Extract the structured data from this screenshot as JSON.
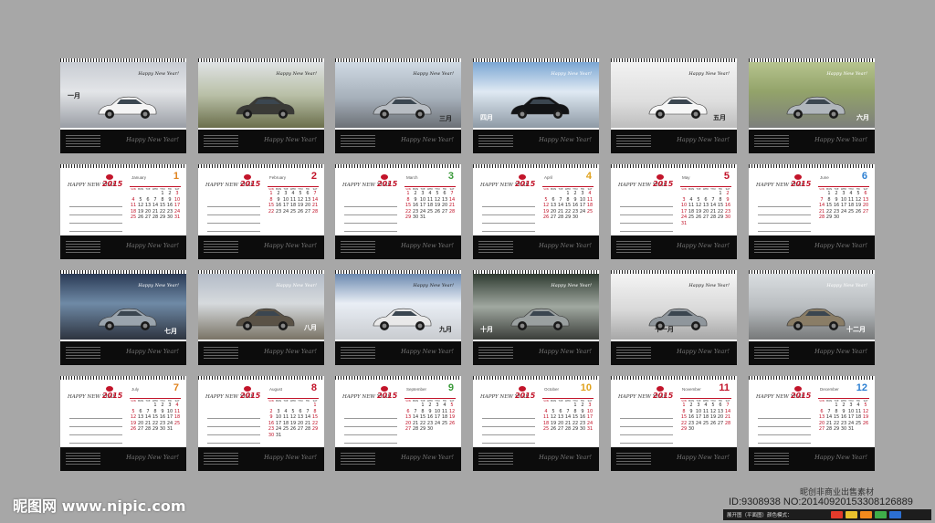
{
  "colors": {
    "background": "#a7a7a7",
    "strip": "#0c0c0c",
    "accent_red": "#c2142a"
  },
  "strip_script": "Happy New Year!",
  "photo_caption": "Happy New Year!",
  "photo_rows": [
    {
      "cards": [
        {
          "label": "一月"
        },
        {
          "label": ""
        },
        {
          "label": "三月"
        },
        {
          "label": "四月"
        },
        {
          "label": "五月"
        },
        {
          "label": "六月"
        }
      ]
    },
    {
      "cards": [
        {
          "label": "七月"
        },
        {
          "label": "八月"
        },
        {
          "label": "九月"
        },
        {
          "label": "十月"
        },
        {
          "label": "十一月"
        },
        {
          "label": "十二月"
        }
      ]
    }
  ],
  "calendar": {
    "logo_text": "HAPPY NEW YEAR",
    "year": "2015",
    "weekday_headers": [
      "SUN",
      "MON",
      "TUE",
      "WED",
      "THU",
      "FRI",
      "SAT"
    ],
    "months": [
      {
        "name": "January",
        "number": "1",
        "weeks": [
          [
            "",
            "",
            "",
            "",
            "1",
            "2",
            "3"
          ],
          [
            "4",
            "5",
            "6",
            "7",
            "8",
            "9",
            "10"
          ],
          [
            "11",
            "12",
            "13",
            "14",
            "15",
            "16",
            "17"
          ],
          [
            "18",
            "19",
            "20",
            "21",
            "22",
            "23",
            "24"
          ],
          [
            "25",
            "26",
            "27",
            "28",
            "29",
            "30",
            "31"
          ]
        ]
      },
      {
        "name": "February",
        "number": "2",
        "weeks": [
          [
            "1",
            "2",
            "3",
            "4",
            "5",
            "6",
            "7"
          ],
          [
            "8",
            "9",
            "10",
            "11",
            "12",
            "13",
            "14"
          ],
          [
            "15",
            "16",
            "17",
            "18",
            "19",
            "20",
            "21"
          ],
          [
            "22",
            "23",
            "24",
            "25",
            "26",
            "27",
            "28"
          ]
        ]
      },
      {
        "name": "March",
        "number": "3",
        "weeks": [
          [
            "1",
            "2",
            "3",
            "4",
            "5",
            "6",
            "7"
          ],
          [
            "8",
            "9",
            "10",
            "11",
            "12",
            "13",
            "14"
          ],
          [
            "15",
            "16",
            "17",
            "18",
            "19",
            "20",
            "21"
          ],
          [
            "22",
            "23",
            "24",
            "25",
            "26",
            "27",
            "28"
          ],
          [
            "29",
            "30",
            "31",
            "",
            "",
            "",
            ""
          ]
        ]
      },
      {
        "name": "April",
        "number": "4",
        "weeks": [
          [
            "",
            "",
            "",
            "1",
            "2",
            "3",
            "4"
          ],
          [
            "5",
            "6",
            "7",
            "8",
            "9",
            "10",
            "11"
          ],
          [
            "12",
            "13",
            "14",
            "15",
            "16",
            "17",
            "18"
          ],
          [
            "19",
            "20",
            "21",
            "22",
            "23",
            "24",
            "25"
          ],
          [
            "26",
            "27",
            "28",
            "29",
            "30",
            "",
            ""
          ]
        ]
      },
      {
        "name": "May",
        "number": "5",
        "weeks": [
          [
            "",
            "",
            "",
            "",
            "",
            "1",
            "2"
          ],
          [
            "3",
            "4",
            "5",
            "6",
            "7",
            "8",
            "9"
          ],
          [
            "10",
            "11",
            "12",
            "13",
            "14",
            "15",
            "16"
          ],
          [
            "17",
            "18",
            "19",
            "20",
            "21",
            "22",
            "23"
          ],
          [
            "24",
            "25",
            "26",
            "27",
            "28",
            "29",
            "30"
          ],
          [
            "31",
            "",
            "",
            "",
            "",
            "",
            ""
          ]
        ]
      },
      {
        "name": "June",
        "number": "6",
        "weeks": [
          [
            "",
            "1",
            "2",
            "3",
            "4",
            "5",
            "6"
          ],
          [
            "7",
            "8",
            "9",
            "10",
            "11",
            "12",
            "13"
          ],
          [
            "14",
            "15",
            "16",
            "17",
            "18",
            "19",
            "20"
          ],
          [
            "21",
            "22",
            "23",
            "24",
            "25",
            "26",
            "27"
          ],
          [
            "28",
            "29",
            "30",
            "",
            "",
            "",
            ""
          ]
        ]
      },
      {
        "name": "July",
        "number": "7",
        "weeks": [
          [
            "",
            "",
            "",
            "1",
            "2",
            "3",
            "4"
          ],
          [
            "5",
            "6",
            "7",
            "8",
            "9",
            "10",
            "11"
          ],
          [
            "12",
            "13",
            "14",
            "15",
            "16",
            "17",
            "18"
          ],
          [
            "19",
            "20",
            "21",
            "22",
            "23",
            "24",
            "25"
          ],
          [
            "26",
            "27",
            "28",
            "29",
            "30",
            "31",
            ""
          ]
        ]
      },
      {
        "name": "August",
        "number": "8",
        "weeks": [
          [
            "",
            "",
            "",
            "",
            "",
            "",
            "1"
          ],
          [
            "2",
            "3",
            "4",
            "5",
            "6",
            "7",
            "8"
          ],
          [
            "9",
            "10",
            "11",
            "12",
            "13",
            "14",
            "15"
          ],
          [
            "16",
            "17",
            "18",
            "19",
            "20",
            "21",
            "22"
          ],
          [
            "23",
            "24",
            "25",
            "26",
            "27",
            "28",
            "29"
          ],
          [
            "30",
            "31",
            "",
            "",
            "",
            "",
            ""
          ]
        ]
      },
      {
        "name": "September",
        "number": "9",
        "weeks": [
          [
            "",
            "",
            "1",
            "2",
            "3",
            "4",
            "5"
          ],
          [
            "6",
            "7",
            "8",
            "9",
            "10",
            "11",
            "12"
          ],
          [
            "13",
            "14",
            "15",
            "16",
            "17",
            "18",
            "19"
          ],
          [
            "20",
            "21",
            "22",
            "23",
            "24",
            "25",
            "26"
          ],
          [
            "27",
            "28",
            "29",
            "30",
            "",
            "",
            ""
          ]
        ]
      },
      {
        "name": "October",
        "number": "10",
        "weeks": [
          [
            "",
            "",
            "",
            "",
            "1",
            "2",
            "3"
          ],
          [
            "4",
            "5",
            "6",
            "7",
            "8",
            "9",
            "10"
          ],
          [
            "11",
            "12",
            "13",
            "14",
            "15",
            "16",
            "17"
          ],
          [
            "18",
            "19",
            "20",
            "21",
            "22",
            "23",
            "24"
          ],
          [
            "25",
            "26",
            "27",
            "28",
            "29",
            "30",
            "31"
          ]
        ]
      },
      {
        "name": "November",
        "number": "11",
        "weeks": [
          [
            "1",
            "2",
            "3",
            "4",
            "5",
            "6",
            "7"
          ],
          [
            "8",
            "9",
            "10",
            "11",
            "12",
            "13",
            "14"
          ],
          [
            "15",
            "16",
            "17",
            "18",
            "19",
            "20",
            "21"
          ],
          [
            "22",
            "23",
            "24",
            "25",
            "26",
            "27",
            "28"
          ],
          [
            "29",
            "30",
            "",
            "",
            "",
            "",
            ""
          ]
        ]
      },
      {
        "name": "December",
        "number": "12",
        "weeks": [
          [
            "",
            "",
            "1",
            "2",
            "3",
            "4",
            "5"
          ],
          [
            "6",
            "7",
            "8",
            "9",
            "10",
            "11",
            "12"
          ],
          [
            "13",
            "14",
            "15",
            "16",
            "17",
            "18",
            "19"
          ],
          [
            "20",
            "21",
            "22",
            "23",
            "24",
            "25",
            "26"
          ],
          [
            "27",
            "28",
            "29",
            "30",
            "31",
            "",
            ""
          ]
        ]
      }
    ]
  },
  "footer": {
    "watermark": "昵图网 www.nipic.com",
    "product_label": "昵创非商业出售素材",
    "id_line": "ID:9308938 NO:20140920153308126889",
    "bar_text": "展开图（平面图）颜色模式：",
    "chips": [
      "C",
      "Y",
      "Ai",
      "CDR",
      "PS"
    ]
  }
}
